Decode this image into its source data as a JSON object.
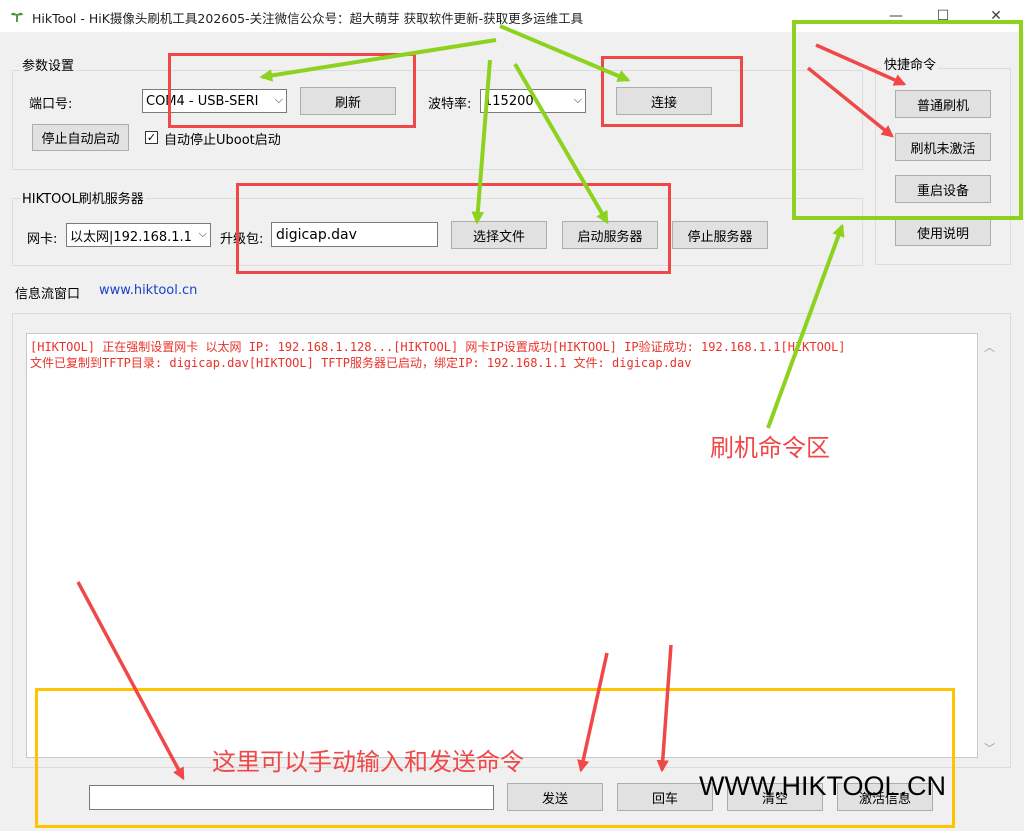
{
  "window": {
    "title": "HikTool - HiK摄像头刷机工具202605-关注微信公众号：超大萌芽 获取软件更新-获取更多运维工具",
    "min_glyph": "—",
    "max_glyph": "☐",
    "close_glyph": "✕"
  },
  "params": {
    "group_label": "参数设置",
    "port_label": "端口号:",
    "port_value": "COM4 - USB-SERI",
    "refresh_label": "刷新",
    "baud_label": "波特率:",
    "baud_value": "115200",
    "connect_label": "连接",
    "stop_autostart_label": "停止自动启动",
    "auto_stop_uboot_label": "自动停止Uboot启动",
    "auto_stop_uboot_checked": true
  },
  "server": {
    "group_label": "HIKTOOL刷机服务器",
    "nic_label": "网卡:",
    "nic_value": "以太网|192.168.1.1",
    "package_label": "升级包:",
    "package_value": "digicap.dav",
    "choose_file_label": "选择文件",
    "start_server_label": "启动服务器",
    "stop_server_label": "停止服务器"
  },
  "quick": {
    "group_label": "快捷命令",
    "buttons": [
      "普通刷机",
      "刷机未激活",
      "重启设备",
      "使用说明"
    ]
  },
  "info": {
    "label": "信息流窗口",
    "link": "www.hiktool.cn",
    "log_lines": [
      "[HIKTOOL] 正在强制设置网卡 以太网 IP: 192.168.1.128...[HIKTOOL] 网卡IP设置成功[HIKTOOL] IP验证成功: 192.168.1.1[HIKTOOL]",
      "文件已复制到TFTP目录: digicap.dav[HIKTOOL] TFTP服务器已启动，绑定IP: 192.168.1.1 文件: digicap.dav"
    ]
  },
  "command": {
    "input_value": "",
    "send_label": "发送",
    "enter_label": "回车",
    "clear_label": "清空",
    "activate_label": "激活信息"
  },
  "annotations": {
    "flash_area_label": "刷机命令区",
    "manual_input_label": "这里可以手动输入和发送命令",
    "watermark": "WWW.HIKTOOL.CN",
    "colors": {
      "red": "#f04848",
      "green": "#8cd21e",
      "yellow": "#ffc400"
    }
  }
}
